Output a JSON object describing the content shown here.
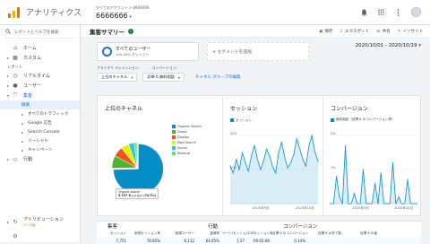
{
  "header": {
    "app_name": "アナリティクス",
    "breadcrumb": "すべてのアカウント > 6666666",
    "property": "6666666"
  },
  "sidebar": {
    "search_placeholder": "レポートとヘルプを検索",
    "home": "ホーム",
    "custom": "カスタム",
    "reports_label": "レポート",
    "realtime": "リアルタイム",
    "users": "ユーザー",
    "acquisition": "集客",
    "sub": [
      "概要",
      "すべてのトラフィック",
      "Google 広告",
      "Search Console",
      "ソーシャル",
      "キャンペーン"
    ],
    "behavior": "行動",
    "attribution": "アトリビューション",
    "attribution_beta": "ベータ版",
    "settings_icon": "gear-icon"
  },
  "main": {
    "title": "集客サマリー",
    "actions": [
      "保存",
      "エクスポート",
      "共有",
      "インサイト"
    ],
    "segment1_title": "すべてのユーザー",
    "segment1_sub": "100.00% セッション",
    "segment_add": "+ セグメントを追加",
    "date_range": "2020/10/01 - 2020/10/19",
    "primary_dim_label": "プライマリ ディメンション:",
    "conversion_label": "コンバージョン:",
    "primary_dim_value": "上位のチャネル",
    "conversion_value": "診断 6 無料相談",
    "channel_group_link": "チャネル グループの編集"
  },
  "cards": {
    "channels_title": "上位のチャネル",
    "sessions_title": "セッション",
    "conversions_title": "コンバージョン",
    "sessions_legend": "セッション",
    "conversions_legend": "無料相談（目標 6 のコンバージョン率）",
    "pie_tooltip_1": "Organic Search",
    "pie_tooltip_2": "5,737 セッション (74.7%)"
  },
  "table": {
    "groups": [
      "集客",
      "行動",
      "コンバージョン"
    ],
    "headers": [
      "セッション",
      "新規セッション率",
      "新規ユーザー",
      "直帰率",
      "ページ/セッション",
      "平均セッション時間",
      "目標 6 のコンバージョン率",
      "目標 6 の完了数",
      "目標 6 の値"
    ],
    "values": [
      "7,751",
      "78.85%",
      "6,112",
      "64.65%",
      "1.37",
      "00:01:06",
      "0.14%",
      "",
      ""
    ]
  },
  "chart_data": [
    {
      "type": "pie",
      "title": "上位のチャネル",
      "categories": [
        "Organic Search",
        "Direct",
        "Display",
        "Paid Search",
        "Social",
        "Referral"
      ],
      "values": [
        74.7,
        8.2,
        6.4,
        5.3,
        3.6,
        1.8
      ],
      "colors": [
        "#058dc7",
        "#50b432",
        "#ed561b",
        "#edef00",
        "#24cbe5",
        "#64e572"
      ]
    },
    {
      "type": "line",
      "title": "セッション",
      "x": [
        "2020年9月",
        "2020年10月"
      ],
      "series": [
        {
          "name": "セッション",
          "values": [
            110,
            90,
            130,
            100,
            150,
            120,
            95,
            140,
            170,
            130,
            100,
            125,
            160,
            140,
            110,
            90,
            150,
            180,
            135,
            105,
            120,
            145,
            190,
            160,
            130,
            110,
            170,
            200,
            150,
            125
          ]
        }
      ],
      "ylim": [
        0,
        200
      ],
      "yticks": [
        "200",
        "100"
      ]
    },
    {
      "type": "line",
      "title": "コンバージョン",
      "x": [
        "2020年9月",
        "2020年10月"
      ],
      "series": [
        {
          "name": "無料相談（目標 6 のコンバージョン率）",
          "values": [
            0,
            0,
            0.8,
            0.2,
            0,
            1.7,
            0,
            0,
            0.3,
            0,
            0,
            1.0,
            0,
            0,
            0,
            0.6,
            0,
            0.9,
            0,
            0,
            0,
            1.2,
            0,
            0.2,
            0,
            0,
            0.7,
            0,
            0,
            0
          ]
        }
      ],
      "ylim": [
        0,
        2
      ],
      "yticks": [
        "2%",
        "1%"
      ]
    }
  ]
}
